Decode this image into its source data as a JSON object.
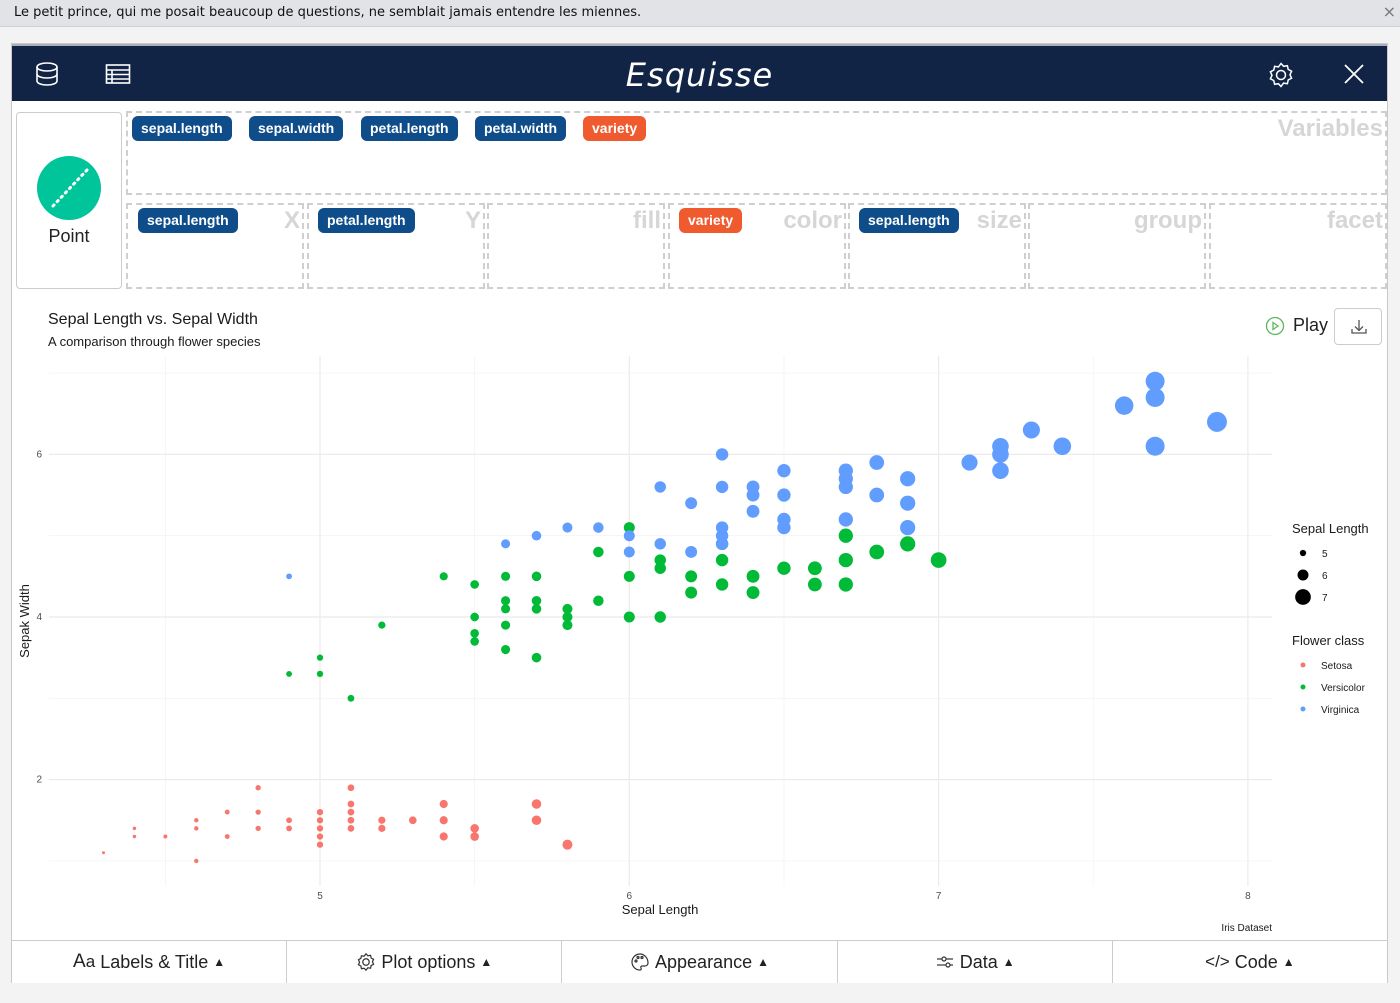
{
  "notice": {
    "text": "Le petit prince, qui me posait beaucoup de questions, ne semblait jamais entendre les miennes.",
    "close_icon": "×"
  },
  "header": {
    "title": "Esquisse",
    "left_icons": [
      "database-icon",
      "table-icon"
    ],
    "right_icons": [
      "gear-icon",
      "close-icon"
    ]
  },
  "geom": {
    "label": "Point",
    "color": "#00c49a"
  },
  "variables": {
    "label": "Variables",
    "items": [
      {
        "name": "sepal.length",
        "type": "num"
      },
      {
        "name": "sepal.width",
        "type": "num"
      },
      {
        "name": "petal.length",
        "type": "num"
      },
      {
        "name": "petal.width",
        "type": "num"
      },
      {
        "name": "variety",
        "type": "cat"
      }
    ]
  },
  "mappings": [
    {
      "label": "X",
      "value": "sepal.length",
      "type": "num"
    },
    {
      "label": "Y",
      "value": "petal.length",
      "type": "num"
    },
    {
      "label": "fill",
      "value": null,
      "type": null
    },
    {
      "label": "color",
      "value": "variety",
      "type": "cat"
    },
    {
      "label": "size",
      "value": "sepal.length",
      "type": "num"
    },
    {
      "label": "group",
      "value": null,
      "type": null
    },
    {
      "label": "facet",
      "value": null,
      "type": null
    }
  ],
  "colors": {
    "num_badge": "#0f4d8a",
    "cat_badge": "#ef5a2f",
    "header_bg": "#112446"
  },
  "plot_controls": {
    "play_label": "Play",
    "download_icon": "download-icon"
  },
  "bottom_tabs": [
    {
      "label": "Labels & Title",
      "icon": "text-icon",
      "glyph": "Aa"
    },
    {
      "label": "Plot options",
      "icon": "gear-icon",
      "glyph": "⚙"
    },
    {
      "label": "Appearance",
      "icon": "palette-icon",
      "glyph": "🎨"
    },
    {
      "label": "Data",
      "icon": "sliders-icon",
      "glyph": "⚟"
    },
    {
      "label": "Code",
      "icon": "code-icon",
      "glyph": "</>"
    }
  ],
  "chart_data": {
    "type": "scatter",
    "title": "Sepal Length vs. Sepal Width",
    "subtitle": "A comparison through flower species",
    "xlabel": "Sepal Length",
    "ylabel": "Sepak Width",
    "caption": "Iris Dataset",
    "xlim": [
      4.2,
      8.08
    ],
    "ylim": [
      0.85,
      7.2
    ],
    "xticks": [
      5,
      6,
      7,
      8
    ],
    "yticks": [
      2,
      4,
      6
    ],
    "grid": true,
    "legends": [
      {
        "title": "Sepal Length",
        "type": "size",
        "entries": [
          {
            "label": "5",
            "value": 5
          },
          {
            "label": "6",
            "value": 6
          },
          {
            "label": "7",
            "value": 7
          }
        ],
        "position": "right"
      },
      {
        "title": "Flower class",
        "type": "color",
        "entries": [
          {
            "label": "Setosa",
            "color": "#f8766d"
          },
          {
            "label": "Versicolor",
            "color": "#00ba38"
          },
          {
            "label": "Virginica",
            "color": "#619cff"
          }
        ],
        "position": "right"
      }
    ],
    "series": [
      {
        "name": "Setosa",
        "color": "#f8766d",
        "points": [
          [
            4.3,
            1.1
          ],
          [
            4.4,
            1.4
          ],
          [
            4.4,
            1.3
          ],
          [
            4.5,
            1.3
          ],
          [
            4.6,
            1.5
          ],
          [
            4.6,
            1.4
          ],
          [
            4.6,
            1.0
          ],
          [
            4.7,
            1.6
          ],
          [
            4.7,
            1.3
          ],
          [
            4.8,
            1.9
          ],
          [
            4.8,
            1.6
          ],
          [
            4.8,
            1.4
          ],
          [
            4.9,
            1.5
          ],
          [
            4.9,
            1.4
          ],
          [
            5.0,
            1.6
          ],
          [
            5.0,
            1.5
          ],
          [
            5.0,
            1.4
          ],
          [
            5.0,
            1.3
          ],
          [
            5.0,
            1.2
          ],
          [
            5.1,
            1.9
          ],
          [
            5.1,
            1.7
          ],
          [
            5.1,
            1.6
          ],
          [
            5.1,
            1.5
          ],
          [
            5.1,
            1.4
          ],
          [
            5.2,
            1.5
          ],
          [
            5.2,
            1.4
          ],
          [
            5.3,
            1.5
          ],
          [
            5.4,
            1.7
          ],
          [
            5.4,
            1.5
          ],
          [
            5.4,
            1.3
          ],
          [
            5.5,
            1.4
          ],
          [
            5.5,
            1.3
          ],
          [
            5.7,
            1.7
          ],
          [
            5.7,
            1.5
          ],
          [
            5.8,
            1.2
          ]
        ]
      },
      {
        "name": "Versicolor",
        "color": "#00ba38",
        "points": [
          [
            4.9,
            3.3
          ],
          [
            5.0,
            3.5
          ],
          [
            5.0,
            3.3
          ],
          [
            5.1,
            3.0
          ],
          [
            5.2,
            3.9
          ],
          [
            5.4,
            4.5
          ],
          [
            5.5,
            4.4
          ],
          [
            5.5,
            4.0
          ],
          [
            5.5,
            3.8
          ],
          [
            5.5,
            3.7
          ],
          [
            5.6,
            4.5
          ],
          [
            5.6,
            4.2
          ],
          [
            5.6,
            4.1
          ],
          [
            5.6,
            3.9
          ],
          [
            5.6,
            3.6
          ],
          [
            5.7,
            4.5
          ],
          [
            5.7,
            4.2
          ],
          [
            5.7,
            4.1
          ],
          [
            5.7,
            3.5
          ],
          [
            5.8,
            4.1
          ],
          [
            5.8,
            4.0
          ],
          [
            5.8,
            3.9
          ],
          [
            5.9,
            4.8
          ],
          [
            5.9,
            4.2
          ],
          [
            6.0,
            5.1
          ],
          [
            6.0,
            4.5
          ],
          [
            6.0,
            4.0
          ],
          [
            6.1,
            4.7
          ],
          [
            6.1,
            4.6
          ],
          [
            6.1,
            4.0
          ],
          [
            6.2,
            4.5
          ],
          [
            6.2,
            4.3
          ],
          [
            6.3,
            4.9
          ],
          [
            6.3,
            4.7
          ],
          [
            6.3,
            4.4
          ],
          [
            6.4,
            4.5
          ],
          [
            6.4,
            4.3
          ],
          [
            6.5,
            4.6
          ],
          [
            6.6,
            4.6
          ],
          [
            6.6,
            4.4
          ],
          [
            6.7,
            5.0
          ],
          [
            6.7,
            4.7
          ],
          [
            6.7,
            4.4
          ],
          [
            6.8,
            4.8
          ],
          [
            6.9,
            4.9
          ],
          [
            7.0,
            4.7
          ]
        ]
      },
      {
        "name": "Virginica",
        "color": "#619cff",
        "points": [
          [
            4.9,
            4.5
          ],
          [
            5.6,
            4.9
          ],
          [
            5.7,
            5.0
          ],
          [
            5.8,
            5.1
          ],
          [
            5.9,
            5.1
          ],
          [
            6.0,
            5.0
          ],
          [
            6.0,
            4.8
          ],
          [
            6.1,
            5.6
          ],
          [
            6.1,
            4.9
          ],
          [
            6.2,
            5.4
          ],
          [
            6.2,
            4.8
          ],
          [
            6.3,
            6.0
          ],
          [
            6.3,
            5.6
          ],
          [
            6.3,
            5.1
          ],
          [
            6.3,
            5.0
          ],
          [
            6.3,
            4.9
          ],
          [
            6.4,
            5.6
          ],
          [
            6.4,
            5.5
          ],
          [
            6.4,
            5.3
          ],
          [
            6.5,
            5.8
          ],
          [
            6.5,
            5.5
          ],
          [
            6.5,
            5.2
          ],
          [
            6.5,
            5.1
          ],
          [
            6.7,
            5.8
          ],
          [
            6.7,
            5.7
          ],
          [
            6.7,
            5.6
          ],
          [
            6.7,
            5.2
          ],
          [
            6.8,
            5.9
          ],
          [
            6.8,
            5.5
          ],
          [
            6.9,
            5.7
          ],
          [
            6.9,
            5.4
          ],
          [
            6.9,
            5.1
          ],
          [
            7.1,
            5.9
          ],
          [
            7.2,
            6.1
          ],
          [
            7.2,
            6.0
          ],
          [
            7.2,
            5.8
          ],
          [
            7.3,
            6.3
          ],
          [
            7.4,
            6.1
          ],
          [
            7.6,
            6.6
          ],
          [
            7.7,
            6.9
          ],
          [
            7.7,
            6.7
          ],
          [
            7.7,
            6.1
          ],
          [
            7.9,
            6.4
          ]
        ]
      }
    ]
  }
}
